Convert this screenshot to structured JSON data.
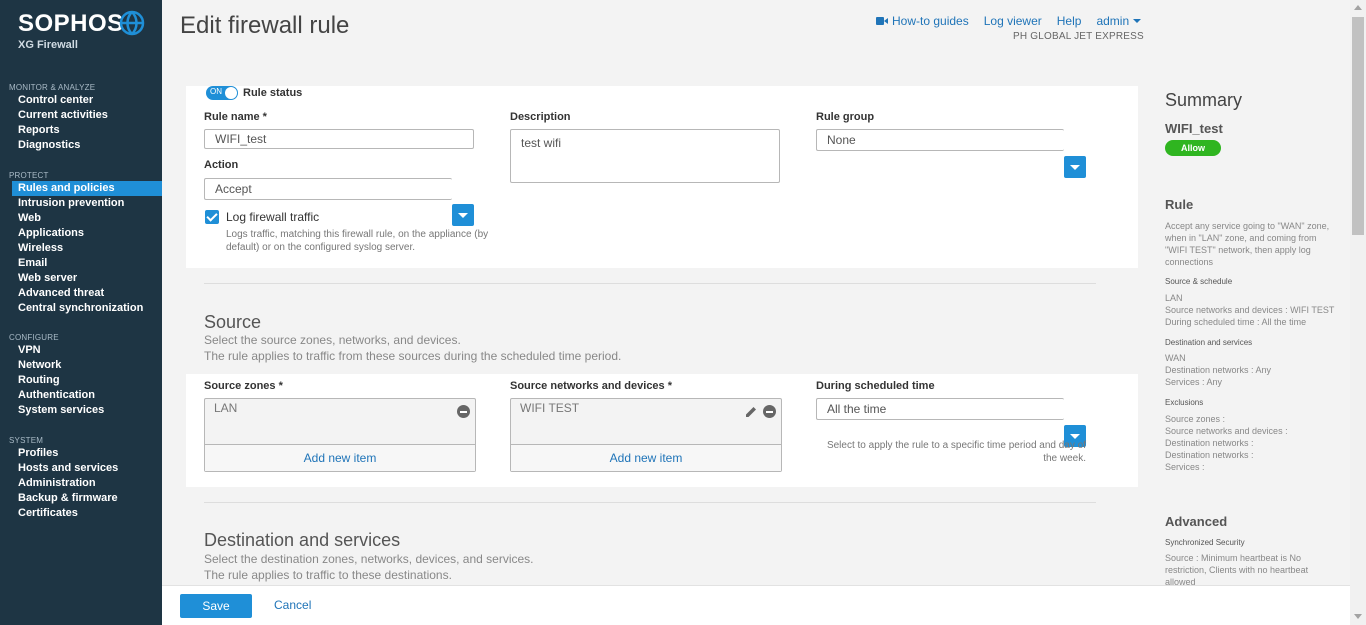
{
  "brand": {
    "name": "SOPHOS",
    "product": "XG Firewall"
  },
  "sidebar": {
    "sections": [
      {
        "heading": "MONITOR & ANALYZE",
        "items": [
          "Control center",
          "Current activities",
          "Reports",
          "Diagnostics"
        ]
      },
      {
        "heading": "PROTECT",
        "items": [
          "Rules and policies",
          "Intrusion prevention",
          "Web",
          "Applications",
          "Wireless",
          "Email",
          "Web server",
          "Advanced threat",
          "Central synchronization"
        ]
      },
      {
        "heading": "CONFIGURE",
        "items": [
          "VPN",
          "Network",
          "Routing",
          "Authentication",
          "System services"
        ]
      },
      {
        "heading": "SYSTEM",
        "items": [
          "Profiles",
          "Hosts and services",
          "Administration",
          "Backup & firmware",
          "Certificates"
        ]
      }
    ],
    "active": "Rules and policies"
  },
  "header": {
    "title": "Edit firewall rule",
    "howto": "How-to guides",
    "logviewer": "Log viewer",
    "help": "Help",
    "admin": "admin",
    "org": "PH GLOBAL JET EXPRESS"
  },
  "rule": {
    "toggle_text": "ON",
    "status_label": "Rule status",
    "name_label": "Rule name *",
    "name_value": "WIFI_test",
    "desc_label": "Description",
    "desc_value": "test wifi",
    "group_label": "Rule group",
    "group_value": "None",
    "action_label": "Action",
    "action_value": "Accept",
    "log_label": "Log firewall traffic",
    "log_hint": "Logs traffic, matching this firewall rule, on the appliance (by default) or on the configured syslog server."
  },
  "source": {
    "title": "Source",
    "desc1": "Select the source zones, networks, and devices.",
    "desc2": "The rule applies to traffic from these sources during the scheduled time period.",
    "zones_label": "Source zones *",
    "zones_item": "LAN",
    "nets_label": "Source networks and devices *",
    "nets_item": "WIFI TEST",
    "add_new": "Add new item",
    "time_label": "During scheduled time",
    "time_value": "All the time",
    "time_hint": "Select to apply the rule to a specific time period and day of the week."
  },
  "destination": {
    "title": "Destination and services",
    "desc1": "Select the destination zones, networks, devices, and services.",
    "desc2": "The rule applies to traffic to these destinations."
  },
  "summary": {
    "title": "Summary",
    "rule_name": "WIFI_test",
    "badge": "Allow",
    "rule_heading": "Rule",
    "rule_text": "Accept any service going to \"WAN\" zone, when in \"LAN\" zone, and coming from \"WIFI TEST\" network, then apply log connections",
    "src_heading": "Source & schedule",
    "src_lines": [
      "LAN",
      "Source networks and devices : WIFI TEST",
      "During scheduled time : All the time"
    ],
    "dst_heading": "Destination and services",
    "dst_lines": [
      "WAN",
      "Destination networks : Any",
      "Services : Any"
    ],
    "exc_heading": "Exclusions",
    "exc_lines": [
      "Source zones :",
      "Source networks and devices :",
      "Destination networks :",
      "Destination networks :",
      "Services :"
    ],
    "adv_heading": "Advanced",
    "sync_heading": "Synchronized Security",
    "sync_text": "Source : Minimum heartbeat is No restriction, Clients with no heartbeat allowed"
  },
  "footer": {
    "save": "Save",
    "cancel": "Cancel"
  },
  "colors": {
    "sidebar": "#1e3544",
    "accent": "#1f8fd7",
    "allow": "#2fb520"
  }
}
